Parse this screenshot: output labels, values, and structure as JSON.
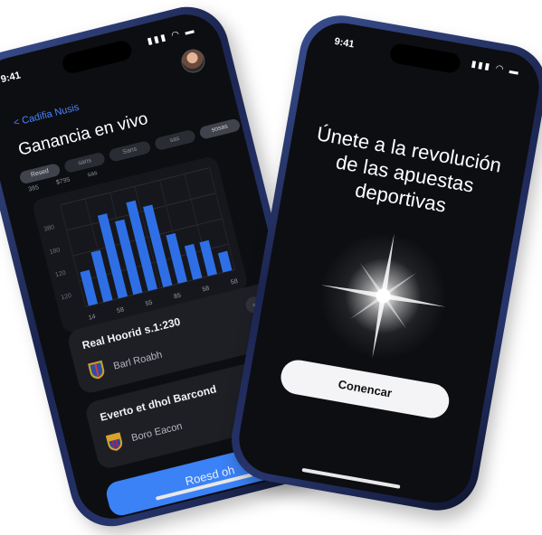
{
  "left_screen": {
    "status_time": "9:41",
    "status_icons": "▮▮▮ ◠ ▬",
    "back_link": "< Cadifia Nusis",
    "title": "Ganancia en vivo",
    "tabs": [
      "Resed",
      "sans",
      "Sans",
      "sas",
      "sosas"
    ],
    "sub_tabs": [
      "385",
      "$795",
      "sas"
    ],
    "chart_data": {
      "type": "bar",
      "y_ticks": [
        "380",
        "180",
        "120",
        "120"
      ],
      "x_ticks": [
        "14",
        "58",
        "55",
        "85",
        "58",
        "58"
      ],
      "values": [
        42,
        62,
        103,
        91,
        110,
        100,
        60,
        42,
        42,
        24
      ],
      "ylim": [
        0,
        120
      ],
      "bar_color": "#2f6fe6"
    },
    "matches": [
      {
        "title": "Real Hoorid s.1:230",
        "team": "Barl Roabh",
        "badge": "◦"
      },
      {
        "title": "Everto et dhol Barcond",
        "team": "Boro Eacon",
        "badge": ""
      }
    ],
    "bet_button": "Roesd oh"
  },
  "right_screen": {
    "status_time": "9:41",
    "status_icons": "▮▮▮ ◠ ▬",
    "headline": "Únete a la revolución de las apuestas deportivas",
    "cta_button": "Conencar"
  },
  "colors": {
    "accent_blue": "#3b82f6",
    "screen_bg": "#0d0e12",
    "frame_blue": "#1c2550"
  }
}
